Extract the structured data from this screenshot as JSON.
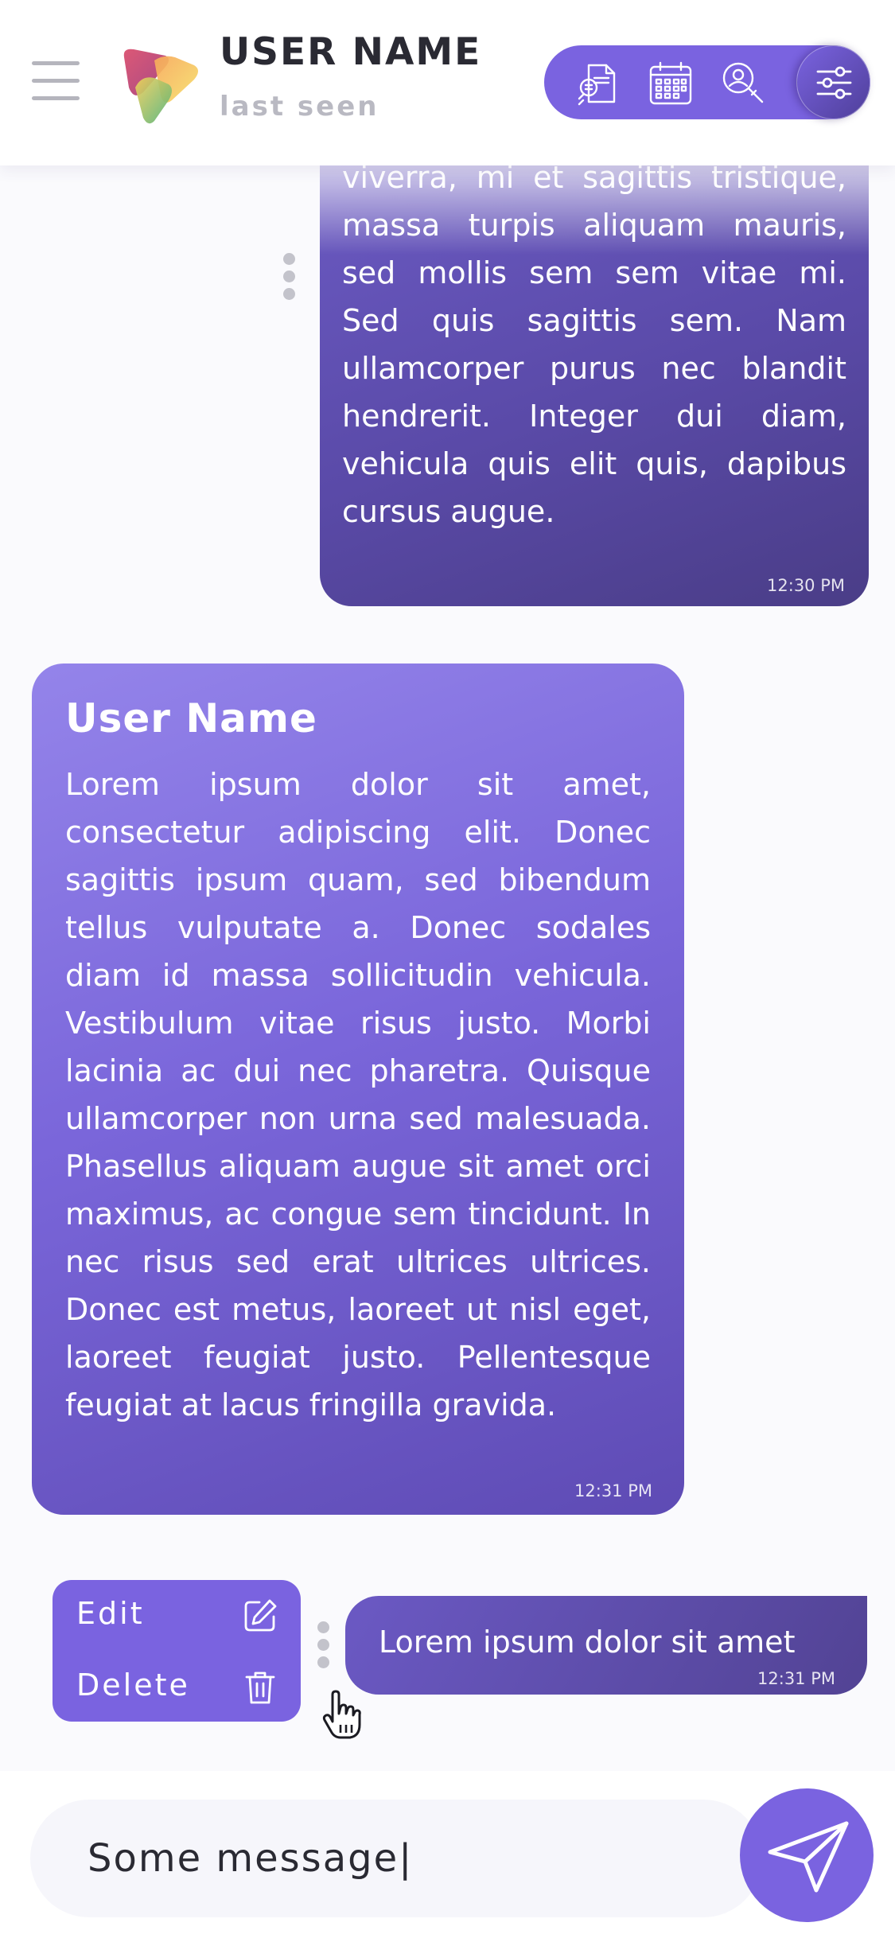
{
  "header": {
    "user_name": "USER NAME",
    "status": "last seen",
    "icons": [
      "menu-icon",
      "app-logo",
      "document-search-icon",
      "calendar-icon",
      "user-search-icon",
      "filter-sliders-icon"
    ]
  },
  "messages": [
    {
      "text": "ullamcorper finibus. Vivamus viverra, mi et sagittis tristique, massa turpis aliquam mauris, sed mollis sem sem vitae mi. Sed quis sagittis sem. Nam ullamcorper purus nec blandit hendrerit. Integer dui diam, vehicula quis elit quis, dapibus cursus augue.",
      "time": "12:30 PM"
    },
    {
      "sender": "User Name",
      "text": "Lorem ipsum dolor sit amet, consectetur adipiscing elit. Donec sagittis ipsum quam, sed bibendum tellus vulputate a. Donec sodales diam id massa sollicitudin vehicula. Vestibulum vitae risus justo. Morbi lacinia ac dui nec pharetra. Quisque ullamcorper non urna sed malesuada. Phasellus aliquam augue sit amet orci maximus, ac congue sem tincidunt. In nec risus sed erat ultrices ultrices. Donec est metus, laoreet ut nisl eget, laoreet feugiat justo. Pellentesque feugiat at lacus fringilla gravida.",
      "time": "12:31 PM"
    },
    {
      "text": "Lorem ipsum dolor sit amet",
      "time": "12:31 PM"
    }
  ],
  "context_menu": {
    "edit_label": "Edit",
    "delete_label": "Delete"
  },
  "composer": {
    "value": "Some message|"
  },
  "colors": {
    "accent": "#7a63e0",
    "bubble_dark": "#524394",
    "text_dark": "#2a2a33",
    "muted": "#b9b9c2"
  }
}
